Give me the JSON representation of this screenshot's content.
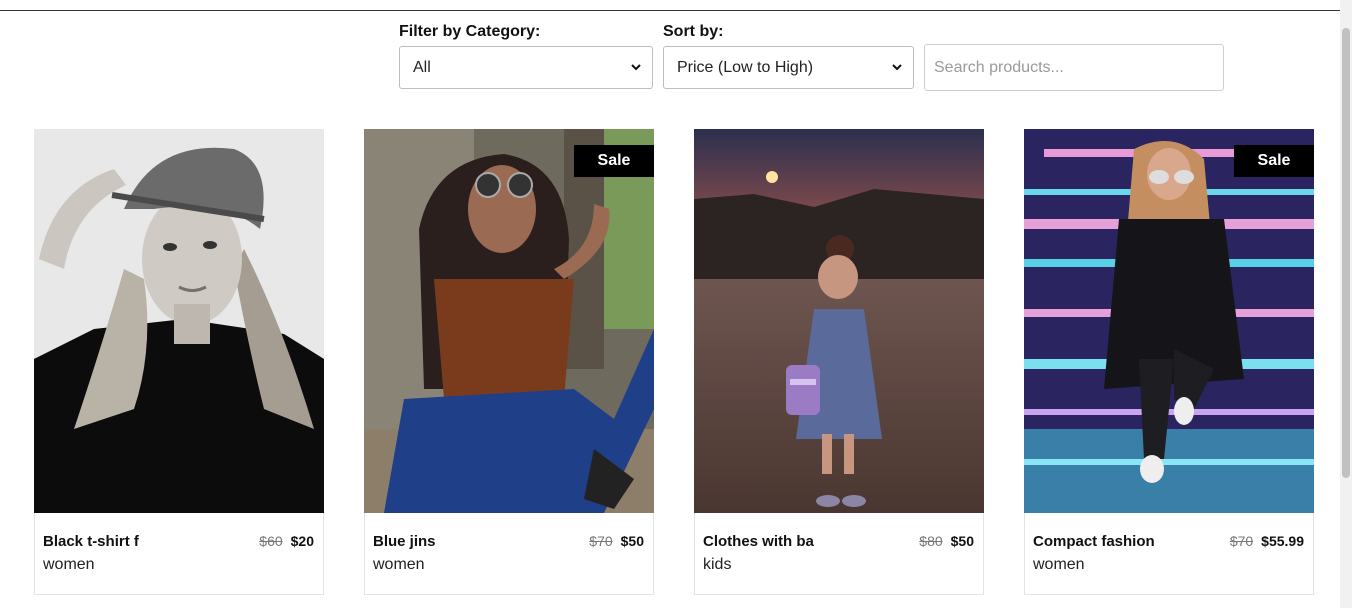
{
  "filters": {
    "category_label": "Filter by Category:",
    "category_value": "All",
    "sort_label": "Sort by:",
    "sort_value": "Price (Low to High)",
    "search_placeholder": "Search products..."
  },
  "products": [
    {
      "name": "Black t-shirt f",
      "category": "women",
      "old_price": "$60",
      "price": "$20",
      "badge": ""
    },
    {
      "name": "Blue jins",
      "category": "women",
      "old_price": "$70",
      "price": "$50",
      "badge": "Sale"
    },
    {
      "name": "Clothes with ba",
      "category": "kids",
      "old_price": "$80",
      "price": "$50",
      "badge": ""
    },
    {
      "name": "Compact fashion",
      "category": "women",
      "old_price": "$70",
      "price": "$55.99",
      "badge": "Sale"
    }
  ],
  "colors": {
    "badge_bg": "#000000",
    "border": "#e3e3e3"
  }
}
